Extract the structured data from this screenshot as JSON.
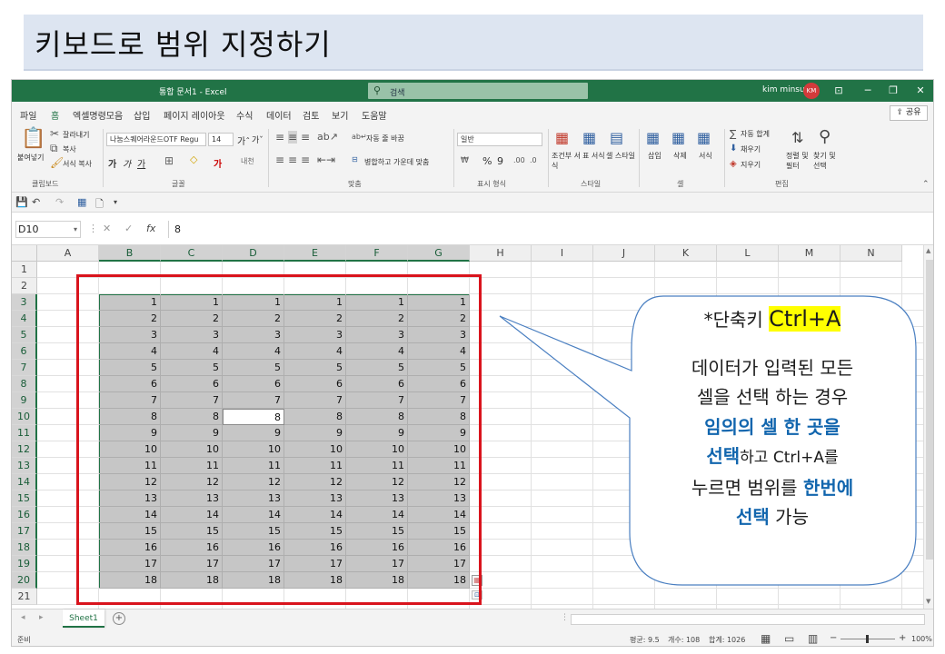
{
  "slide": {
    "title": "키보드로 범위 지정하기"
  },
  "window": {
    "doc_title": "통합 문서1  -  Excel",
    "search_placeholder": "검색",
    "user_name": "kim minsu",
    "user_initials": "KM",
    "share_label": "공유"
  },
  "menu": [
    "파일",
    "홈",
    "엑셀명령모음",
    "삽입",
    "페이지 레이아웃",
    "수식",
    "데이터",
    "검토",
    "보기",
    "도움말"
  ],
  "ribbon": {
    "paste": "붙여넣기",
    "cut": "잘라내기",
    "copy": "복사",
    "format_painter": "서식 복사",
    "clipboard_group": "클립보드",
    "font_name": "나눔스퀘어라운드OTF Regu",
    "font_size": "14",
    "bold": "가",
    "italic": "가",
    "underline": "가",
    "font_group": "글꼴",
    "wrap_text": "자동 줄 바꿈",
    "merge_center": "병합하고 가운데 맞춤",
    "align_group": "맞춤",
    "number_format": "일반",
    "number_group": "표시 형식",
    "cond_format": "조건부 서식",
    "table_format": "표 서식",
    "cell_style": "셀 스타일",
    "style_group": "스타일",
    "insert": "삽입",
    "delete": "삭제",
    "format": "서식",
    "cell_group": "셀",
    "autosum": "자동 합계",
    "fill": "채우기",
    "clear": "지우기",
    "sort_filter": "정렬 및 필터",
    "find_select": "찾기 및 선택",
    "edit_group": "편집"
  },
  "formula_bar": {
    "name_box": "D10",
    "value": "8"
  },
  "grid": {
    "columns": [
      "A",
      "B",
      "C",
      "D",
      "E",
      "F",
      "G",
      "H",
      "I",
      "J",
      "K",
      "L",
      "M",
      "N"
    ],
    "rows": [
      "1",
      "2",
      "3",
      "4",
      "5",
      "6",
      "7",
      "8",
      "9",
      "10",
      "11",
      "12",
      "13",
      "14",
      "15",
      "16",
      "17",
      "18",
      "19",
      "20",
      "21"
    ],
    "data_values": [
      "1",
      "2",
      "3",
      "4",
      "5",
      "6",
      "7",
      "8",
      "9",
      "10",
      "11",
      "12",
      "13",
      "14",
      "15",
      "16",
      "17",
      "18"
    ],
    "active_cell": "D10"
  },
  "sheet": {
    "tab": "Sheet1"
  },
  "status": {
    "ready": "준비",
    "average": "평균: 9.5",
    "count": "개수: 108",
    "sum": "합계: 1026",
    "zoom": "100%"
  },
  "callout": {
    "shortcut_prefix": "*단축키 ",
    "shortcut_key": "Ctrl+A",
    "line1": "데이터가 입력된 모든",
    "line2": "셀을 선택 하는 경우",
    "line3_bold": "임의의 셀 한 곳을",
    "line4_bold": "선택",
    "line4_rest": "하고 Ctrl+A를",
    "line5_plain": "누르면 범위를 ",
    "line5_bold": "한번에",
    "line6_bold": "선택",
    "line6_rest": " 가능",
    "border_color": "#4a7fc1",
    "fill_color": "#ffffff"
  }
}
